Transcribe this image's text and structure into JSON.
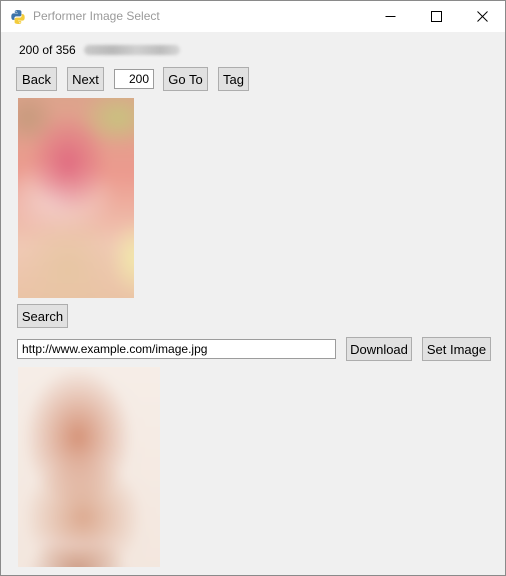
{
  "window": {
    "title": "Performer Image Select",
    "icon": "python-icon"
  },
  "nav": {
    "counter": "200 of 356",
    "back_label": "Back",
    "next_label": "Next",
    "goto_value": "200",
    "goto_label": "Go To",
    "tag_label": "Tag"
  },
  "search": {
    "button_label": "Search"
  },
  "url": {
    "value": "http://www.example.com/image.jpg",
    "download_label": "Download",
    "set_image_label": "Set Image"
  }
}
